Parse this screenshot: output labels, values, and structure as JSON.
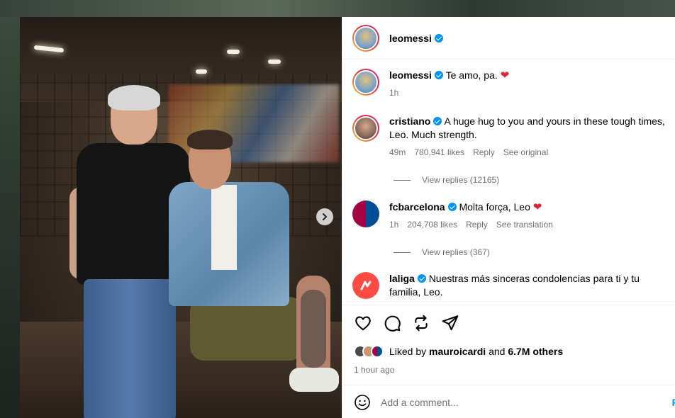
{
  "post": {
    "author": "leomessi",
    "caption": "Te amo, pa.",
    "caption_time": "1h",
    "verified": true
  },
  "comments": [
    {
      "user": "cristiano",
      "text": "A huge hug to you and yours in these tough times, Leo. Much strength.",
      "time": "49m",
      "likes": "780,941 likes",
      "reply": "Reply",
      "extra": "See original",
      "view_replies": "View replies (12165)"
    },
    {
      "user": "fcbarcelona",
      "text": "Molta força, Leo",
      "time": "1h",
      "likes": "204,708 likes",
      "reply": "Reply",
      "extra": "See translation",
      "view_replies": "View replies (367)"
    },
    {
      "user": "laliga",
      "text": "Nuestras más sinceras condolencias para ti y tu familia, Leo."
    }
  ],
  "likes": {
    "prefix": "Liked by",
    "user": "mauroicardi",
    "conj": "and",
    "others": "6.7M others"
  },
  "time_ago": "1 hour ago",
  "comment_box": {
    "placeholder": "Add a comment...",
    "post_label": "P"
  },
  "colors": {
    "verified": "#0095f6",
    "heart": "#e0243a",
    "muted": "#737373"
  },
  "icons": [
    "heart-icon",
    "comment-icon",
    "repost-icon",
    "share-icon",
    "emoji-icon",
    "chevron-right-icon",
    "verified-icon"
  ]
}
